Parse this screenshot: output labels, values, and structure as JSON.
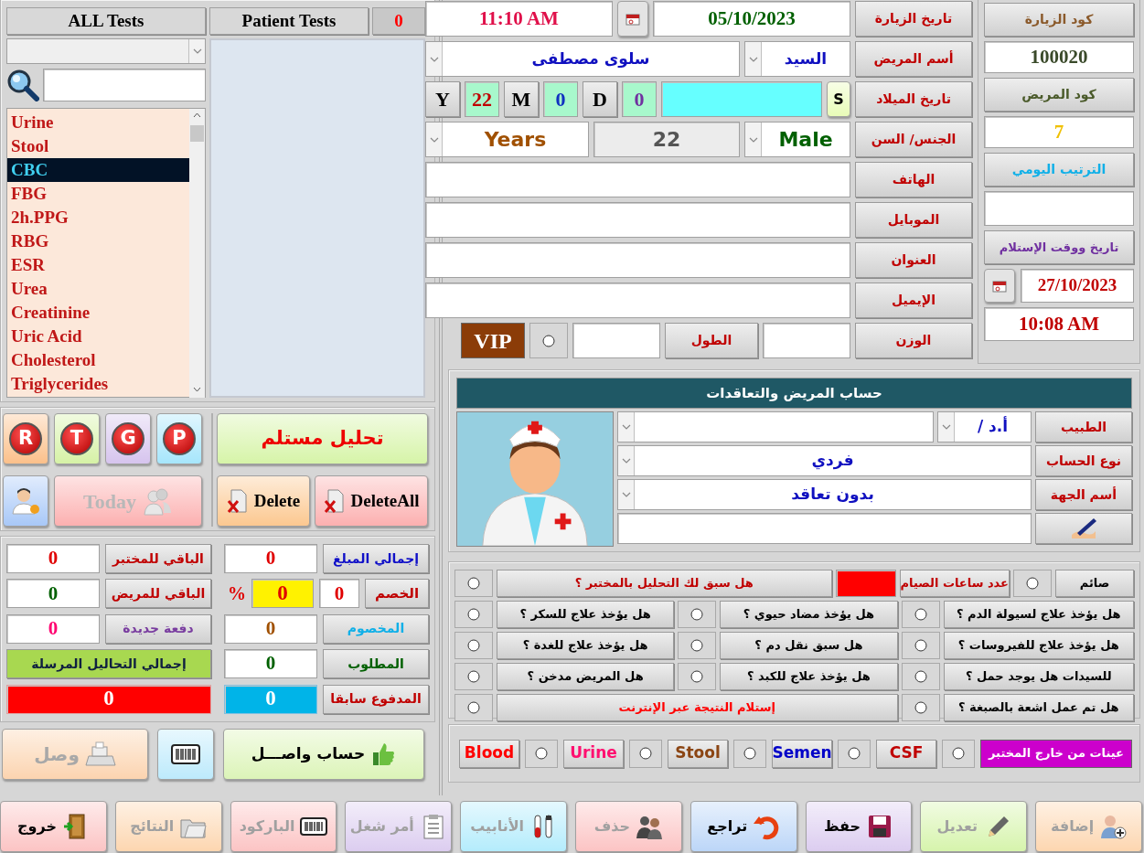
{
  "tests_panel": {
    "all_tests_tab": "ALL Tests",
    "patient_tests_tab": "Patient Tests",
    "patient_tests_count": "0",
    "tests": [
      {
        "name": "Urine",
        "selected": false
      },
      {
        "name": "Stool",
        "selected": false
      },
      {
        "name": "CBC",
        "selected": true
      },
      {
        "name": "FBG",
        "selected": false
      },
      {
        "name": "2h.PPG",
        "selected": false
      },
      {
        "name": "RBG",
        "selected": false
      },
      {
        "name": "ESR",
        "selected": false
      },
      {
        "name": "Urea",
        "selected": false
      },
      {
        "name": "Creatinine",
        "selected": false
      },
      {
        "name": "Uric Acid",
        "selected": false
      },
      {
        "name": "Cholesterol",
        "selected": false
      },
      {
        "name": "Triglycerides",
        "selected": false
      }
    ]
  },
  "shortcut_buttons": [
    {
      "letter": "P",
      "color": "#a6e6fc"
    },
    {
      "letter": "G",
      "color": "#d6c4ee"
    },
    {
      "letter": "T",
      "color": "#d6f2a6"
    },
    {
      "letter": "R",
      "color": "#fcc08a"
    }
  ],
  "today_button": {
    "label": "Today",
    "disabled": true
  },
  "received_test_button": "تحليل مستلم",
  "delete_button": "Delete",
  "delete_all_button": "DeleteAll",
  "payment": [
    {
      "kind": "amount",
      "label": {
        "text": "إجمالي المبلغ",
        "color": "#1010c8"
      },
      "value": {
        "text": "0",
        "color": "#e00000"
      }
    },
    {
      "kind": "amount",
      "label": {
        "text": "الباقي للمختبر",
        "color": "#c00000"
      },
      "value": {
        "text": "0",
        "color": "#e00000"
      }
    },
    {
      "kind": "discount",
      "label": {
        "text": "الخصم",
        "color": "#c00000"
      },
      "value": {
        "text": "0",
        "color": "#e00000"
      },
      "percent": {
        "text": "0",
        "color": "#e00000"
      },
      "percent_sign": "%"
    },
    {
      "kind": "amount",
      "label": {
        "text": "الباقي للمريض",
        "color": "#c00000"
      },
      "value": {
        "text": "0",
        "color": "#006000"
      }
    },
    {
      "kind": "amount",
      "label": {
        "text": "المخصوم",
        "color": "#10b0e8"
      },
      "value": {
        "text": "0",
        "color": "#a05000"
      }
    },
    {
      "kind": "amount",
      "label": {
        "text": "دفعة جديدة",
        "color": "#7a3ea0"
      },
      "value": {
        "text": "0",
        "color": "#ff0070"
      }
    },
    {
      "kind": "amount",
      "label": {
        "text": "المطلوب",
        "color": "#006000"
      },
      "value": {
        "text": "0",
        "color": "#006000"
      }
    },
    {
      "kind": "banner",
      "label": {
        "text": "إجمالي التحاليل المرسلة",
        "color": "#102040"
      }
    },
    {
      "kind": "paid",
      "label": {
        "text": "المدفوع سابقا",
        "color": "#c00000"
      },
      "value": {
        "text": "0",
        "color": "#ffffff"
      }
    },
    {
      "kind": "total",
      "value": {
        "text": "0",
        "color": "#ffffff"
      }
    }
  ],
  "paid_account_button": "حساب واصـــل",
  "receipt_button": {
    "label": "وصل",
    "disabled": true
  },
  "visit": {
    "visit_date_label": "تاريخ الزيارة",
    "visit_date": "05/10/2023",
    "visit_time": "11:10 AM",
    "patient_name_label": "أسم المريض",
    "title": "السيد",
    "patient_name": "سلوى مصطفى",
    "birth_date_label": "تاريخ الميلاد",
    "birth_date_button": "S",
    "age_parts": [
      {
        "unit": "D",
        "value": "0",
        "color": "#7030a0"
      },
      {
        "unit": "M",
        "value": "0",
        "color": "#1030c0"
      },
      {
        "unit": "Y",
        "value": "22",
        "color": "#c00000"
      }
    ],
    "gender_age_label": "الجنس/ السن",
    "gender": "Male",
    "age": "22",
    "age_unit": "Years",
    "contact_fields": [
      {
        "label": "الهاتف"
      },
      {
        "label": "الموبايل"
      },
      {
        "label": "العنوان"
      },
      {
        "label": "الإيميل"
      }
    ],
    "weight_label": "الوزن",
    "height_label": "الطول",
    "vip": {
      "label": "VIP",
      "checked": false
    }
  },
  "visit_side": {
    "visit_code_label": "كود الزيارة",
    "visit_code": "100020",
    "patient_code_label": "كود المريض",
    "patient_code": "7",
    "daily_order_label": "الترتيب اليومي",
    "receipt_datetime_label": "تاريخ ووقت الإستلام",
    "receipt_date": "27/10/2023",
    "receipt_time": "10:08 AM"
  },
  "account": {
    "title": "حساب المريض والتعاقدات",
    "doctor_label": "الطبيب",
    "doctor_title": "أ.د /",
    "account_type_label": "نوع الحساب",
    "account_type": "فردي",
    "organization_label": "أسم الجهة",
    "organization": "بدون تعاقد"
  },
  "questions": [
    [
      {
        "kind": "fasting",
        "text": "صائم",
        "color": "#000000",
        "checked": false,
        "hours_label": "عدد ساعات الصيام"
      },
      {
        "kind": "question",
        "text": "هل سبق لك التحليل بالمختبر ؟",
        "color": "#c00000",
        "checked": false
      }
    ],
    [
      {
        "kind": "question",
        "text": "هل يؤخذ علاج لسيولة الدم ؟",
        "color": "#000000",
        "checked": false
      },
      {
        "kind": "question",
        "text": "هل يؤخذ مضاد حيوي ؟",
        "color": "#000000",
        "checked": false
      },
      {
        "kind": "question",
        "text": "هل يؤخذ علاج للسكر ؟",
        "color": "#000000",
        "checked": false
      }
    ],
    [
      {
        "kind": "question",
        "text": "هل يؤخذ علاج للفيروسات ؟",
        "color": "#000000",
        "checked": false
      },
      {
        "kind": "question",
        "text": "هل سبق نقل دم ؟",
        "color": "#000000",
        "checked": false
      },
      {
        "kind": "question",
        "text": "هل يؤخذ علاج للغدة ؟",
        "color": "#000000",
        "checked": false
      }
    ],
    [
      {
        "kind": "question",
        "text": "للسيدات هل يوجد حمل ؟",
        "color": "#000000",
        "checked": false
      },
      {
        "kind": "question",
        "text": "هل يؤخذ علاج للكبد ؟",
        "color": "#000000",
        "checked": false
      },
      {
        "kind": "question",
        "text": "هل المريض مدخن ؟",
        "color": "#000000",
        "checked": false
      }
    ],
    [
      {
        "kind": "question",
        "text": "هل تم عمل اشعة بالصبغة ؟",
        "color": "#000000",
        "checked": false
      },
      {
        "kind": "question",
        "text": "إستلام النتيجة عبر الإنترنت",
        "color": "#ff0000",
        "checked": false
      }
    ]
  ],
  "samples": {
    "title": "عينات من خارج المختبر",
    "items": [
      {
        "name": "CSF",
        "color": "#c00000",
        "checked": false
      },
      {
        "name": "Semen",
        "color": "#0000c8",
        "checked": false
      },
      {
        "name": "Stool",
        "color": "#8b4513",
        "checked": false
      },
      {
        "name": "Urine",
        "color": "#ff1070",
        "checked": false
      },
      {
        "name": "Blood",
        "color": "#ff0000",
        "checked": false
      }
    ]
  },
  "toolbar": [
    {
      "label": "إضافة",
      "color": "#fdd6b0",
      "disabled": true
    },
    {
      "label": "تعديل",
      "color": "#d6f4ac",
      "disabled": true
    },
    {
      "label": "حفظ",
      "color": "#dccdf0",
      "disabled": false
    },
    {
      "label": "تراجع",
      "color": "#bcd6f8",
      "disabled": false
    },
    {
      "label": "حذف",
      "color": "#fcc4c4",
      "disabled": true
    },
    {
      "label": "الأنابيب",
      "color": "#b4ecfc",
      "disabled": true
    },
    {
      "label": "أمر شغل",
      "color": "#dccdf0",
      "disabled": true
    },
    {
      "label": "الباركود",
      "color": "#fcc4c4",
      "disabled": true
    },
    {
      "label": "النتائج",
      "color": "#fdd6b0",
      "disabled": true
    },
    {
      "label": "خروج",
      "color": "#fcc4c4",
      "disabled": false
    }
  ]
}
